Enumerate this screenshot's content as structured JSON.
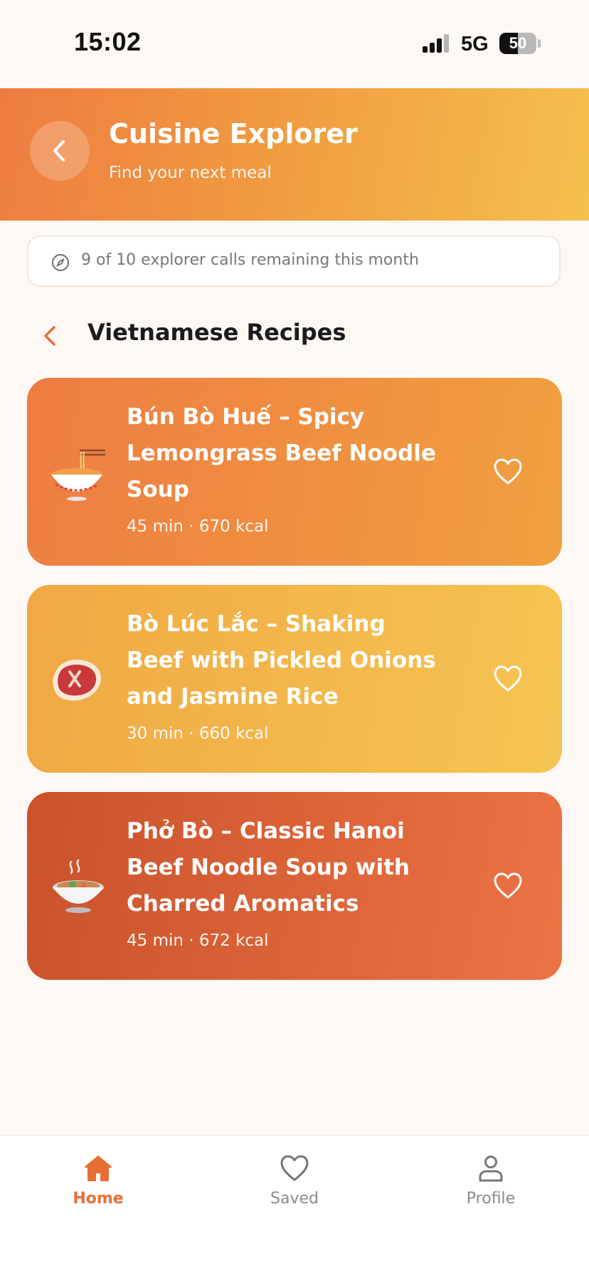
{
  "status_bar": {
    "time": "15:02",
    "network": "5G",
    "battery": "50",
    "battery_level": 0.5
  },
  "header": {
    "title": "Cuisine Explorer",
    "subtitle": "Find your next meal"
  },
  "quota": {
    "text": "9 of 10 explorer calls remaining this month"
  },
  "section": {
    "title": "Vietnamese Recipes"
  },
  "recipes": [
    {
      "title": "Bún Bò Huế – Spicy Lemongrass Beef Noodle Soup",
      "meta": "45 min · 670 kcal",
      "image": "noodle-bowl-icon"
    },
    {
      "title": "Bò Lúc Lắc – Shaking Beef with Pickled Onions and Jasmine Rice",
      "meta": "30 min · 660 kcal",
      "image": "steak-icon"
    },
    {
      "title": "Phở Bò – Classic Hanoi Beef Noodle Soup with Charred Aromatics",
      "meta": "45 min · 672 kcal",
      "image": "soup-bowl-icon"
    }
  ],
  "tabbar": {
    "items": [
      {
        "label": "Home",
        "icon": "home-icon",
        "active": true
      },
      {
        "label": "Saved",
        "icon": "heart-icon",
        "active": false
      },
      {
        "label": "Profile",
        "icon": "user-icon",
        "active": false
      }
    ]
  },
  "colors": {
    "accent": "#e86e36",
    "background": "#fdf8f4"
  }
}
